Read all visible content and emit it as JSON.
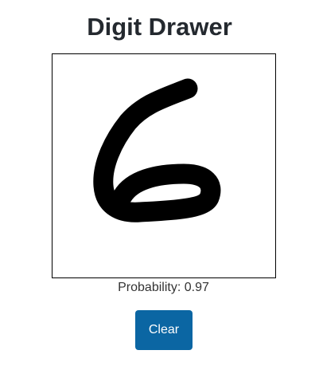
{
  "app": {
    "title": "Digit Drawer"
  },
  "prediction": {
    "label": "Probability:",
    "value": "0.97"
  },
  "controls": {
    "clear_label": "Clear"
  },
  "colors": {
    "accent": "#0b66a3",
    "stroke": "#000000",
    "title": "#24292f"
  }
}
